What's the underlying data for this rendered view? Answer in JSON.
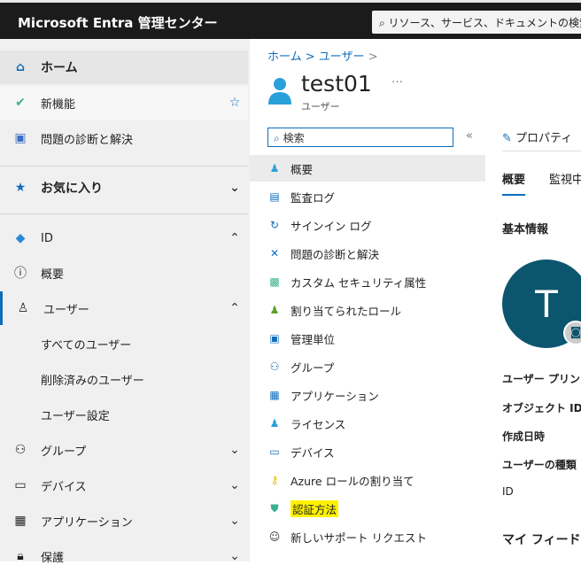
{
  "header": {
    "brand": "Microsoft Entra 管理センター",
    "search_placeholder": "リソース、サービス、ドキュメントの検索 (G+/)"
  },
  "sidebar": {
    "items": [
      {
        "label": "ホーム",
        "icon": "home-icon"
      },
      {
        "label": "新機能",
        "icon": "whats-new-icon"
      },
      {
        "label": "問題の診断と解決",
        "icon": "diagnose-icon"
      },
      {
        "label": "お気に入り",
        "icon": "star-icon"
      },
      {
        "label": "ID",
        "icon": "identity-icon"
      },
      {
        "label": "概要",
        "icon": "info-icon"
      },
      {
        "label": "ユーザー",
        "icon": "user-icon"
      },
      {
        "label": "すべてのユーザー"
      },
      {
        "label": "削除済みのユーザー"
      },
      {
        "label": "ユーザー設定"
      },
      {
        "label": "グループ",
        "icon": "group-icon"
      },
      {
        "label": "デバイス",
        "icon": "device-icon"
      },
      {
        "label": "アプリケーション",
        "icon": "app-icon"
      },
      {
        "label": "保護",
        "icon": "lock-icon"
      }
    ]
  },
  "breadcrumb": [
    "ホーム",
    "ユーザー"
  ],
  "user": {
    "name": "test01",
    "type": "ユーザー",
    "more": "…",
    "initial": "T"
  },
  "menu": {
    "search_placeholder": "検索",
    "collapse": "«",
    "items": [
      "概要",
      "監査ログ",
      "サインイン ログ",
      "問題の診断と解決",
      "カスタム セキュリティ属性",
      "割り当てられたロール",
      "管理単位",
      "グループ",
      "アプリケーション",
      "ライセンス",
      "デバイス",
      "Azure ロールの割り当て",
      "認証方法",
      "新しいサポート リクエスト"
    ]
  },
  "detail": {
    "properties": "プロパティ",
    "tabs": [
      "概要",
      "監視中"
    ],
    "section": "基本情報",
    "fields": [
      "ユーザー プリンシパル名",
      "オブジェクト ID",
      "作成日時",
      "ユーザーの種類",
      "ID"
    ],
    "feed": "マイ フィード"
  },
  "colors": {
    "accent": "#0f6cbd",
    "avatar": "#0b566e",
    "highlight": "#fff200"
  }
}
